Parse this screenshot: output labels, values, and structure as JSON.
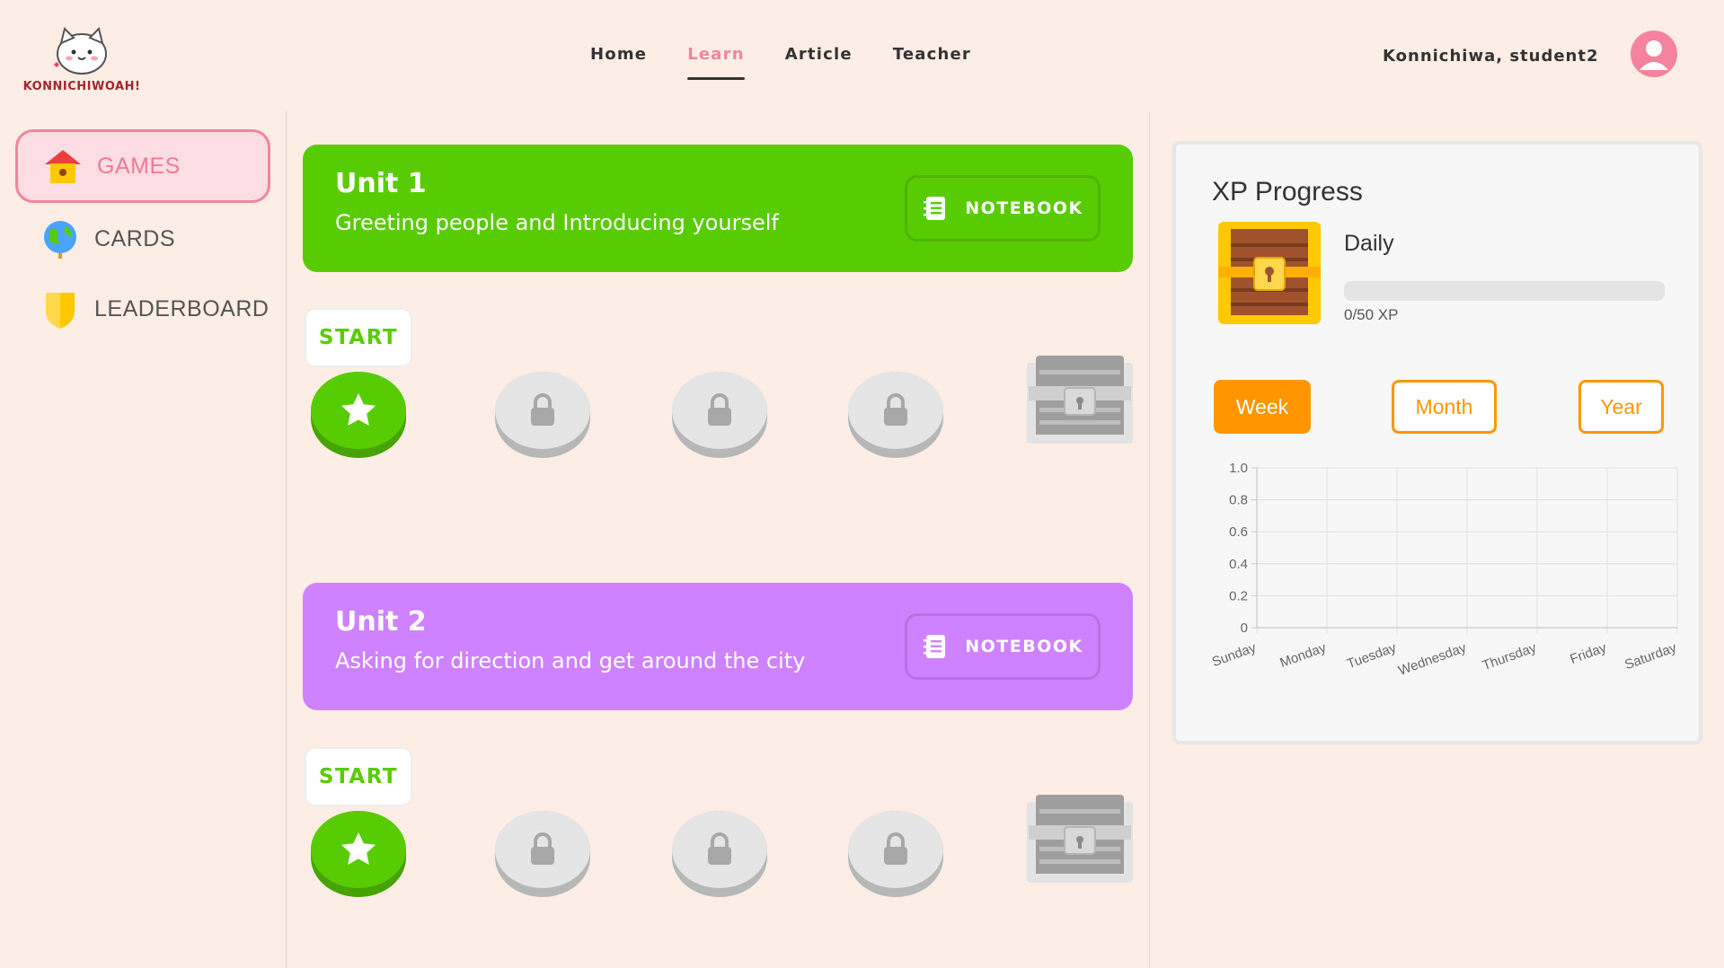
{
  "brand": {
    "logo_text": "KONNICHIWOAH!"
  },
  "nav": {
    "items": [
      {
        "label": "Home",
        "active": false
      },
      {
        "label": "Learn",
        "active": true
      },
      {
        "label": "Article",
        "active": false
      },
      {
        "label": "Teacher",
        "active": false
      }
    ]
  },
  "header": {
    "greeting": "Konnichiwa, student2"
  },
  "sidebar": {
    "items": [
      {
        "label": "GAMES",
        "icon": "house-icon",
        "active": true
      },
      {
        "label": "CARDS",
        "icon": "globe-icon",
        "active": false
      },
      {
        "label": "LEADERBOARD",
        "icon": "shield-icon",
        "active": false
      }
    ]
  },
  "units": [
    {
      "title": "Unit 1",
      "subtitle": "Greeting people and Introducing yourself",
      "notebook_label": "NOTEBOOK",
      "start_label": "START",
      "color": "#58cc02"
    },
    {
      "title": "Unit 2",
      "subtitle": "Asking for direction and get around the city",
      "notebook_label": "NOTEBOOK",
      "start_label": "START",
      "color": "#ce82ff"
    }
  ],
  "xp": {
    "title": "XP Progress",
    "daily_label": "Daily",
    "progress_text": "0/50 XP",
    "current": 0,
    "goal": 50,
    "ranges": [
      {
        "label": "Week",
        "active": true
      },
      {
        "label": "Month",
        "active": false
      },
      {
        "label": "Year",
        "active": false
      }
    ]
  },
  "colors": {
    "accent_orange": "#ff9600",
    "pink": "#f0849f",
    "green": "#58cc02",
    "purple": "#ce82ff"
  },
  "chart_data": {
    "type": "line",
    "categories": [
      "Sunday",
      "Monday",
      "Tuesday",
      "Wednesday",
      "Thursday",
      "Friday",
      "Saturday"
    ],
    "series": [
      {
        "values": []
      }
    ],
    "ylim": [
      0,
      1.0
    ],
    "yticks": [
      "1.0",
      "0.8",
      "0.6",
      "0.4",
      "0.2",
      "0"
    ],
    "grid": true,
    "title": "",
    "xlabel": "",
    "ylabel": ""
  }
}
